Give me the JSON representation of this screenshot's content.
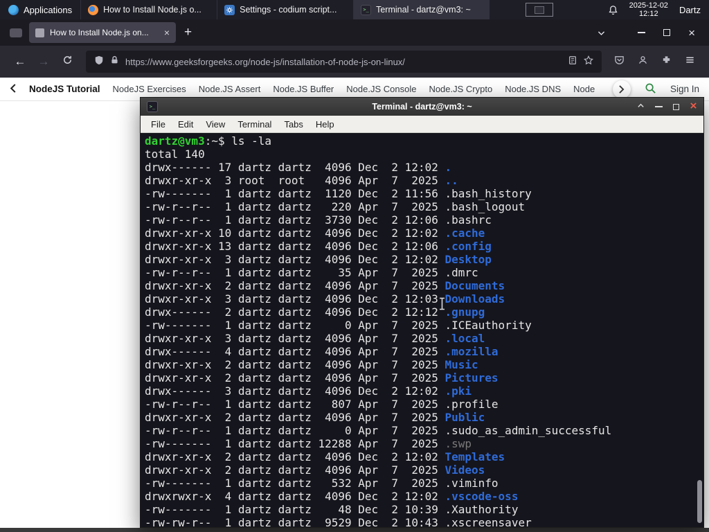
{
  "colors": {
    "prompt_green": "#33d133",
    "dir_blue": "#2f6bd8",
    "dim_gray": "#7a7a7a",
    "terminal_bg": "#15151d",
    "gfg_green": "#2f8d46",
    "close_red": "#ef5c4a"
  },
  "panel": {
    "applications_label": "Applications",
    "windows": [
      {
        "title": "How to Install Node.js o..."
      },
      {
        "title": "Settings - codium script..."
      },
      {
        "title": "Terminal - dartz@vm3: ~"
      }
    ],
    "clock_date": "2025-12-02",
    "clock_time": "12:12",
    "user": "Dartz"
  },
  "browser": {
    "tab_title": "How to Install Node.js on...",
    "url": "https://www.geeksforgeeks.org/node-js/installation-of-node-js-on-linux/"
  },
  "site_nav": {
    "items": [
      {
        "label": "NodeJS Tutorial",
        "cls": "strong"
      },
      {
        "label": "NodeJS Exercises"
      },
      {
        "label": "Node.JS Assert"
      },
      {
        "label": "Node.JS Buffer"
      },
      {
        "label": "Node.JS Console"
      },
      {
        "label": "Node.JS Crypto"
      },
      {
        "label": "Node.JS DNS"
      },
      {
        "label": "Node"
      }
    ],
    "sign_in": "Sign In"
  },
  "terminal": {
    "title": "Terminal - dartz@vm3: ~",
    "menu": [
      "File",
      "Edit",
      "View",
      "Terminal",
      "Tabs",
      "Help"
    ],
    "prompt_user": "dartz@vm3",
    "prompt_suffix": ":~$ ",
    "command": "ls -la",
    "total_line": "total 140",
    "entries": [
      {
        "pre": "drwx------ 17 dartz dartz  4096 Dec  2 12:02 ",
        "name": ".",
        "cls": "dir"
      },
      {
        "pre": "drwxr-xr-x  3 root  root   4096 Apr  7  2025 ",
        "name": "..",
        "cls": "dir"
      },
      {
        "pre": "-rw-------  1 dartz dartz  1120 Dec  2 11:56 ",
        "name": ".bash_history"
      },
      {
        "pre": "-rw-r--r--  1 dartz dartz   220 Apr  7  2025 ",
        "name": ".bash_logout"
      },
      {
        "pre": "-rw-r--r--  1 dartz dartz  3730 Dec  2 12:06 ",
        "name": ".bashrc"
      },
      {
        "pre": "drwxr-xr-x 10 dartz dartz  4096 Dec  2 12:02 ",
        "name": ".cache",
        "cls": "dir"
      },
      {
        "pre": "drwxr-xr-x 13 dartz dartz  4096 Dec  2 12:06 ",
        "name": ".config",
        "cls": "dir"
      },
      {
        "pre": "drwxr-xr-x  3 dartz dartz  4096 Dec  2 12:02 ",
        "name": "Desktop",
        "cls": "dir"
      },
      {
        "pre": "-rw-r--r--  1 dartz dartz    35 Apr  7  2025 ",
        "name": ".dmrc"
      },
      {
        "pre": "drwxr-xr-x  2 dartz dartz  4096 Apr  7  2025 ",
        "name": "Documents",
        "cls": "dir"
      },
      {
        "pre": "drwxr-xr-x  3 dartz dartz  4096 Dec  2 12:03 ",
        "name": "Downloads",
        "cls": "dir"
      },
      {
        "pre": "drwx------  2 dartz dartz  4096 Dec  2 12:12 ",
        "name": ".gnupg",
        "cls": "dir"
      },
      {
        "pre": "-rw-------  1 dartz dartz     0 Apr  7  2025 ",
        "name": ".ICEauthority"
      },
      {
        "pre": "drwxr-xr-x  3 dartz dartz  4096 Apr  7  2025 ",
        "name": ".local",
        "cls": "dir"
      },
      {
        "pre": "drwx------  4 dartz dartz  4096 Apr  7  2025 ",
        "name": ".mozilla",
        "cls": "dir"
      },
      {
        "pre": "drwxr-xr-x  2 dartz dartz  4096 Apr  7  2025 ",
        "name": "Music",
        "cls": "dir"
      },
      {
        "pre": "drwxr-xr-x  2 dartz dartz  4096 Apr  7  2025 ",
        "name": "Pictures",
        "cls": "dir"
      },
      {
        "pre": "drwx------  3 dartz dartz  4096 Dec  2 12:02 ",
        "name": ".pki",
        "cls": "dir"
      },
      {
        "pre": "-rw-r--r--  1 dartz dartz   807 Apr  7  2025 ",
        "name": ".profile"
      },
      {
        "pre": "drwxr-xr-x  2 dartz dartz  4096 Apr  7  2025 ",
        "name": "Public",
        "cls": "dir"
      },
      {
        "pre": "-rw-r--r--  1 dartz dartz     0 Apr  7  2025 ",
        "name": ".sudo_as_admin_successful"
      },
      {
        "pre": "-rw-------  1 dartz dartz 12288 Apr  7  2025 ",
        "name": ".swp",
        "cls": "dim"
      },
      {
        "pre": "drwxr-xr-x  2 dartz dartz  4096 Dec  2 12:02 ",
        "name": "Templates",
        "cls": "dir"
      },
      {
        "pre": "drwxr-xr-x  2 dartz dartz  4096 Apr  7  2025 ",
        "name": "Videos",
        "cls": "dir"
      },
      {
        "pre": "-rw-------  1 dartz dartz   532 Apr  7  2025 ",
        "name": ".viminfo"
      },
      {
        "pre": "drwxrwxr-x  4 dartz dartz  4096 Dec  2 12:02 ",
        "name": ".vscode-oss",
        "cls": "dir"
      },
      {
        "pre": "-rw-------  1 dartz dartz    48 Dec  2 10:39 ",
        "name": ".Xauthority"
      },
      {
        "pre": "-rw-rw-r--  1 dartz dartz  9529 Dec  2 10:43 ",
        "name": ".xscreensaver"
      }
    ]
  }
}
